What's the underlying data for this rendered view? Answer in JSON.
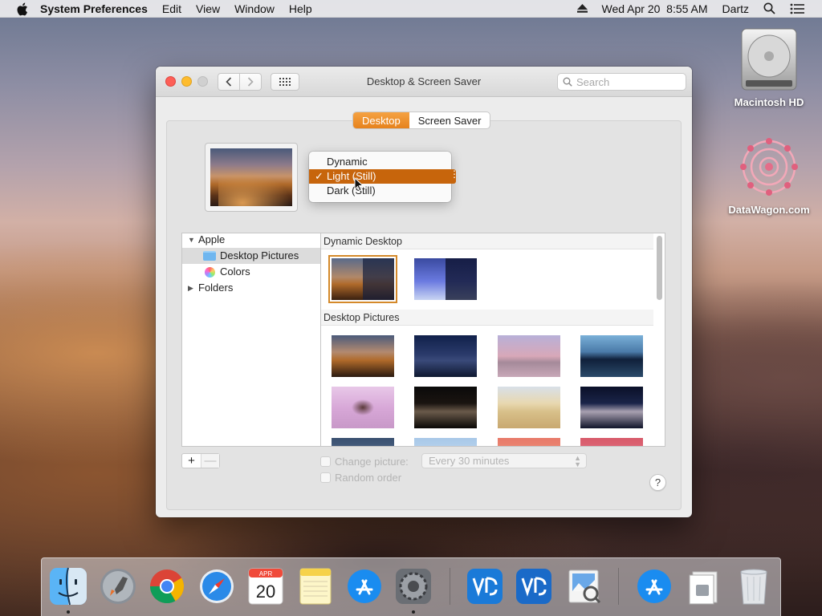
{
  "menubar": {
    "app_name": "System Preferences",
    "menus": [
      "Edit",
      "View",
      "Window",
      "Help"
    ],
    "datetime": "Wed Apr 20  8:55 AM",
    "user": "Dartz"
  },
  "desktop_icons": {
    "hd_label": "Macintosh HD",
    "datawagon_label": "DataWagon.com"
  },
  "window": {
    "title": "Desktop & Screen Saver",
    "search_placeholder": "Search",
    "tabs": [
      "Desktop",
      "Screen Saver"
    ],
    "active_tab": "Desktop"
  },
  "appearance_menu": {
    "items": [
      {
        "label": "Dynamic",
        "selected": false
      },
      {
        "label": "Light (Still)",
        "selected": true
      },
      {
        "label": "Dark (Still)",
        "selected": false
      }
    ],
    "check": "✓"
  },
  "source_list": {
    "items": [
      {
        "label": "Apple",
        "disclosure": "open"
      },
      {
        "label": "Desktop Pictures",
        "selected": true
      },
      {
        "label": "Colors"
      },
      {
        "label": "Folders",
        "disclosure": "closed"
      }
    ]
  },
  "grid": {
    "sections": [
      "Dynamic Desktop",
      "Desktop Pictures"
    ]
  },
  "controls": {
    "add": "+",
    "remove": "—",
    "change_picture_label": "Change picture:",
    "interval": "Every 30 minutes",
    "random_label": "Random order",
    "help": "?"
  },
  "dock": {
    "apps": [
      "finder-icon",
      "launchpad-icon",
      "chrome-icon",
      "safari-icon",
      "calendar-icon",
      "notes-icon",
      "app-store-icon",
      "system-preferences-icon",
      "vnc-viewer-icon",
      "vnc-server-icon",
      "preview-icon",
      "app-store-download-icon",
      "documents-stack-icon",
      "trash-icon"
    ],
    "calendar_month": "APR",
    "calendar_day": "20"
  },
  "colors": {
    "accent": "#e6821c",
    "menu_selection": "#c7650c",
    "close": "#fd5f57",
    "minimize": "#febc2e"
  }
}
